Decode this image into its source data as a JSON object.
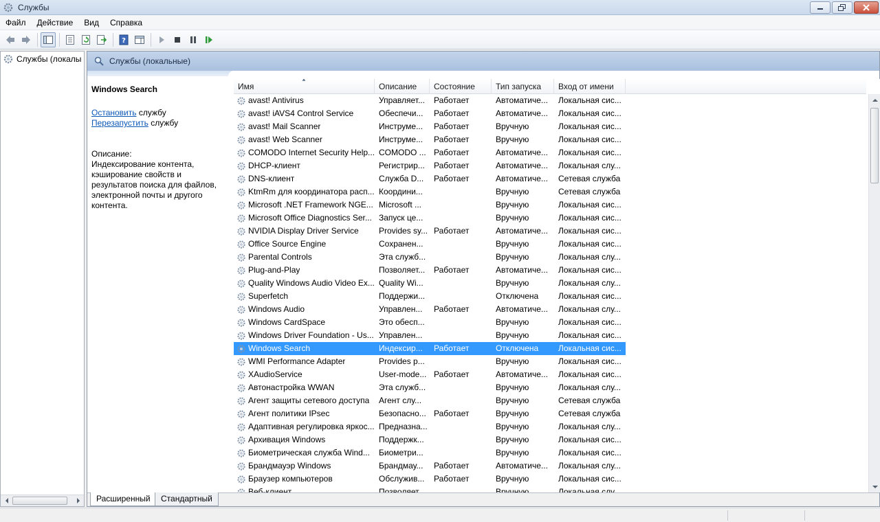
{
  "window": {
    "title": "Службы"
  },
  "menu": [
    "Файл",
    "Действие",
    "Вид",
    "Справка"
  ],
  "tree": {
    "root_label": "Службы (локалы"
  },
  "main": {
    "header_title": "Службы (локальные)",
    "selected_service": "Windows Search",
    "actions": {
      "stop_link": "Остановить",
      "stop_suffix": " службу",
      "restart_link": "Перезапустить",
      "restart_suffix": " службу"
    },
    "description_label": "Описание:",
    "description_text": "Индексирование контента, кэширование свойств и результатов поиска для файлов, электронной почты и другого контента."
  },
  "table": {
    "columns": [
      "Имя",
      "Описание",
      "Состояние",
      "Тип запуска",
      "Вход от имени"
    ],
    "rows": [
      {
        "name": "avast! Antivirus",
        "desc": "Управляет...",
        "state": "Работает",
        "start": "Автоматиче...",
        "logon": "Локальная сис..."
      },
      {
        "name": "avast! iAVS4 Control Service",
        "desc": "Обеспечи...",
        "state": "Работает",
        "start": "Автоматиче...",
        "logon": "Локальная сис..."
      },
      {
        "name": "avast! Mail Scanner",
        "desc": "Инструме...",
        "state": "Работает",
        "start": "Вручную",
        "logon": "Локальная сис..."
      },
      {
        "name": "avast! Web Scanner",
        "desc": "Инструме...",
        "state": "Работает",
        "start": "Вручную",
        "logon": "Локальная сис..."
      },
      {
        "name": "COMODO Internet Security Help...",
        "desc": "COMODO ...",
        "state": "Работает",
        "start": "Автоматиче...",
        "logon": "Локальная сис..."
      },
      {
        "name": "DHCP-клиент",
        "desc": "Регистрир...",
        "state": "Работает",
        "start": "Автоматиче...",
        "logon": "Локальная слу..."
      },
      {
        "name": "DNS-клиент",
        "desc": "Служба D...",
        "state": "Работает",
        "start": "Автоматиче...",
        "logon": "Сетевая служба"
      },
      {
        "name": "KtmRm для координатора расп...",
        "desc": "Координи...",
        "state": "",
        "start": "Вручную",
        "logon": "Сетевая служба"
      },
      {
        "name": "Microsoft .NET Framework NGE...",
        "desc": "Microsoft ...",
        "state": "",
        "start": "Вручную",
        "logon": "Локальная сис..."
      },
      {
        "name": "Microsoft Office Diagnostics Ser...",
        "desc": "Запуск це...",
        "state": "",
        "start": "Вручную",
        "logon": "Локальная сис..."
      },
      {
        "name": "NVIDIA Display Driver Service",
        "desc": "Provides sy...",
        "state": "Работает",
        "start": "Автоматиче...",
        "logon": "Локальная сис..."
      },
      {
        "name": "Office Source Engine",
        "desc": "Сохранен...",
        "state": "",
        "start": "Вручную",
        "logon": "Локальная сис..."
      },
      {
        "name": "Parental Controls",
        "desc": "Эта служб...",
        "state": "",
        "start": "Вручную",
        "logon": "Локальная слу..."
      },
      {
        "name": "Plug-and-Play",
        "desc": "Позволяет...",
        "state": "Работает",
        "start": "Автоматиче...",
        "logon": "Локальная сис..."
      },
      {
        "name": "Quality Windows Audio Video Ex...",
        "desc": "Quality Wi...",
        "state": "",
        "start": "Вручную",
        "logon": "Локальная слу..."
      },
      {
        "name": "Superfetch",
        "desc": "Поддержи...",
        "state": "",
        "start": "Отключена",
        "logon": "Локальная сис..."
      },
      {
        "name": "Windows Audio",
        "desc": "Управлен...",
        "state": "Работает",
        "start": "Автоматиче...",
        "logon": "Локальная слу..."
      },
      {
        "name": "Windows CardSpace",
        "desc": "Это обесп...",
        "state": "",
        "start": "Вручную",
        "logon": "Локальная сис..."
      },
      {
        "name": "Windows Driver Foundation - Us...",
        "desc": "Управлен...",
        "state": "",
        "start": "Вручную",
        "logon": "Локальная сис..."
      },
      {
        "name": "Windows Search",
        "desc": "Индексир...",
        "state": "Работает",
        "start": "Отключена",
        "logon": "Локальная сис...",
        "selected": true
      },
      {
        "name": "WMI Performance Adapter",
        "desc": "Provides p...",
        "state": "",
        "start": "Вручную",
        "logon": "Локальная сис..."
      },
      {
        "name": "XAudioService",
        "desc": "User-mode...",
        "state": "Работает",
        "start": "Автоматиче...",
        "logon": "Локальная сис..."
      },
      {
        "name": "Автонастройка WWAN",
        "desc": "Эта служб...",
        "state": "",
        "start": "Вручную",
        "logon": "Локальная слу..."
      },
      {
        "name": "Агент защиты сетевого доступа",
        "desc": "Агент слу...",
        "state": "",
        "start": "Вручную",
        "logon": "Сетевая служба"
      },
      {
        "name": "Агент политики IPsec",
        "desc": "Безопасно...",
        "state": "Работает",
        "start": "Вручную",
        "logon": "Сетевая служба"
      },
      {
        "name": "Адаптивная регулировка яркос...",
        "desc": "Предназна...",
        "state": "",
        "start": "Вручную",
        "logon": "Локальная слу..."
      },
      {
        "name": "Архивация Windows",
        "desc": "Поддержк...",
        "state": "",
        "start": "Вручную",
        "logon": "Локальная сис..."
      },
      {
        "name": "Биометрическая служба Wind...",
        "desc": "Биометри...",
        "state": "",
        "start": "Вручную",
        "logon": "Локальная сис..."
      },
      {
        "name": "Брандмауэр Windows",
        "desc": "Брандмау...",
        "state": "Работает",
        "start": "Автоматиче...",
        "logon": "Локальная слу..."
      },
      {
        "name": "Браузер компьютеров",
        "desc": "Обслужив...",
        "state": "Работает",
        "start": "Вручную",
        "logon": "Локальная сис..."
      },
      {
        "name": "Веб-клиент",
        "desc": "Позволяет...",
        "state": "",
        "start": "Вручную",
        "logon": "Локальная слу..."
      }
    ]
  },
  "tabs": [
    "Расширенный",
    "Стандартный"
  ],
  "colors": {
    "selection": "#3399ff",
    "link": "#0b58b8",
    "header_band": "#b6cbe5"
  }
}
